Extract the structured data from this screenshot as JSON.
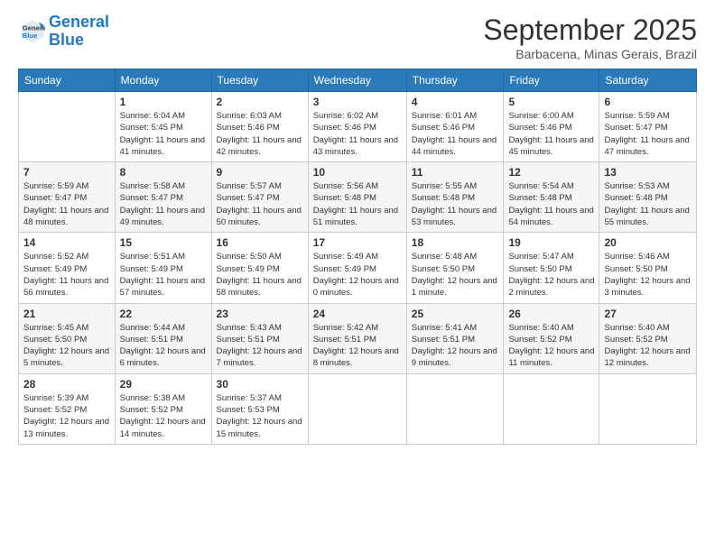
{
  "logo": {
    "line1": "General",
    "line2": "Blue"
  },
  "title": "September 2025",
  "subtitle": "Barbacena, Minas Gerais, Brazil",
  "weekdays": [
    "Sunday",
    "Monday",
    "Tuesday",
    "Wednesday",
    "Thursday",
    "Friday",
    "Saturday"
  ],
  "weeks": [
    [
      {
        "day": "",
        "sunrise": "",
        "sunset": "",
        "daylight": ""
      },
      {
        "day": "1",
        "sunrise": "Sunrise: 6:04 AM",
        "sunset": "Sunset: 5:45 PM",
        "daylight": "Daylight: 11 hours and 41 minutes."
      },
      {
        "day": "2",
        "sunrise": "Sunrise: 6:03 AM",
        "sunset": "Sunset: 5:46 PM",
        "daylight": "Daylight: 11 hours and 42 minutes."
      },
      {
        "day": "3",
        "sunrise": "Sunrise: 6:02 AM",
        "sunset": "Sunset: 5:46 PM",
        "daylight": "Daylight: 11 hours and 43 minutes."
      },
      {
        "day": "4",
        "sunrise": "Sunrise: 6:01 AM",
        "sunset": "Sunset: 5:46 PM",
        "daylight": "Daylight: 11 hours and 44 minutes."
      },
      {
        "day": "5",
        "sunrise": "Sunrise: 6:00 AM",
        "sunset": "Sunset: 5:46 PM",
        "daylight": "Daylight: 11 hours and 45 minutes."
      },
      {
        "day": "6",
        "sunrise": "Sunrise: 5:59 AM",
        "sunset": "Sunset: 5:47 PM",
        "daylight": "Daylight: 11 hours and 47 minutes."
      }
    ],
    [
      {
        "day": "7",
        "sunrise": "Sunrise: 5:59 AM",
        "sunset": "Sunset: 5:47 PM",
        "daylight": "Daylight: 11 hours and 48 minutes."
      },
      {
        "day": "8",
        "sunrise": "Sunrise: 5:58 AM",
        "sunset": "Sunset: 5:47 PM",
        "daylight": "Daylight: 11 hours and 49 minutes."
      },
      {
        "day": "9",
        "sunrise": "Sunrise: 5:57 AM",
        "sunset": "Sunset: 5:47 PM",
        "daylight": "Daylight: 11 hours and 50 minutes."
      },
      {
        "day": "10",
        "sunrise": "Sunrise: 5:56 AM",
        "sunset": "Sunset: 5:48 PM",
        "daylight": "Daylight: 11 hours and 51 minutes."
      },
      {
        "day": "11",
        "sunrise": "Sunrise: 5:55 AM",
        "sunset": "Sunset: 5:48 PM",
        "daylight": "Daylight: 11 hours and 53 minutes."
      },
      {
        "day": "12",
        "sunrise": "Sunrise: 5:54 AM",
        "sunset": "Sunset: 5:48 PM",
        "daylight": "Daylight: 11 hours and 54 minutes."
      },
      {
        "day": "13",
        "sunrise": "Sunrise: 5:53 AM",
        "sunset": "Sunset: 5:48 PM",
        "daylight": "Daylight: 11 hours and 55 minutes."
      }
    ],
    [
      {
        "day": "14",
        "sunrise": "Sunrise: 5:52 AM",
        "sunset": "Sunset: 5:49 PM",
        "daylight": "Daylight: 11 hours and 56 minutes."
      },
      {
        "day": "15",
        "sunrise": "Sunrise: 5:51 AM",
        "sunset": "Sunset: 5:49 PM",
        "daylight": "Daylight: 11 hours and 57 minutes."
      },
      {
        "day": "16",
        "sunrise": "Sunrise: 5:50 AM",
        "sunset": "Sunset: 5:49 PM",
        "daylight": "Daylight: 11 hours and 58 minutes."
      },
      {
        "day": "17",
        "sunrise": "Sunrise: 5:49 AM",
        "sunset": "Sunset: 5:49 PM",
        "daylight": "Daylight: 12 hours and 0 minutes."
      },
      {
        "day": "18",
        "sunrise": "Sunrise: 5:48 AM",
        "sunset": "Sunset: 5:50 PM",
        "daylight": "Daylight: 12 hours and 1 minute."
      },
      {
        "day": "19",
        "sunrise": "Sunrise: 5:47 AM",
        "sunset": "Sunset: 5:50 PM",
        "daylight": "Daylight: 12 hours and 2 minutes."
      },
      {
        "day": "20",
        "sunrise": "Sunrise: 5:46 AM",
        "sunset": "Sunset: 5:50 PM",
        "daylight": "Daylight: 12 hours and 3 minutes."
      }
    ],
    [
      {
        "day": "21",
        "sunrise": "Sunrise: 5:45 AM",
        "sunset": "Sunset: 5:50 PM",
        "daylight": "Daylight: 12 hours and 5 minutes."
      },
      {
        "day": "22",
        "sunrise": "Sunrise: 5:44 AM",
        "sunset": "Sunset: 5:51 PM",
        "daylight": "Daylight: 12 hours and 6 minutes."
      },
      {
        "day": "23",
        "sunrise": "Sunrise: 5:43 AM",
        "sunset": "Sunset: 5:51 PM",
        "daylight": "Daylight: 12 hours and 7 minutes."
      },
      {
        "day": "24",
        "sunrise": "Sunrise: 5:42 AM",
        "sunset": "Sunset: 5:51 PM",
        "daylight": "Daylight: 12 hours and 8 minutes."
      },
      {
        "day": "25",
        "sunrise": "Sunrise: 5:41 AM",
        "sunset": "Sunset: 5:51 PM",
        "daylight": "Daylight: 12 hours and 9 minutes."
      },
      {
        "day": "26",
        "sunrise": "Sunrise: 5:40 AM",
        "sunset": "Sunset: 5:52 PM",
        "daylight": "Daylight: 12 hours and 11 minutes."
      },
      {
        "day": "27",
        "sunrise": "Sunrise: 5:40 AM",
        "sunset": "Sunset: 5:52 PM",
        "daylight": "Daylight: 12 hours and 12 minutes."
      }
    ],
    [
      {
        "day": "28",
        "sunrise": "Sunrise: 5:39 AM",
        "sunset": "Sunset: 5:52 PM",
        "daylight": "Daylight: 12 hours and 13 minutes."
      },
      {
        "day": "29",
        "sunrise": "Sunrise: 5:38 AM",
        "sunset": "Sunset: 5:52 PM",
        "daylight": "Daylight: 12 hours and 14 minutes."
      },
      {
        "day": "30",
        "sunrise": "Sunrise: 5:37 AM",
        "sunset": "Sunset: 5:53 PM",
        "daylight": "Daylight: 12 hours and 15 minutes."
      },
      {
        "day": "",
        "sunrise": "",
        "sunset": "",
        "daylight": ""
      },
      {
        "day": "",
        "sunrise": "",
        "sunset": "",
        "daylight": ""
      },
      {
        "day": "",
        "sunrise": "",
        "sunset": "",
        "daylight": ""
      },
      {
        "day": "",
        "sunrise": "",
        "sunset": "",
        "daylight": ""
      }
    ]
  ]
}
